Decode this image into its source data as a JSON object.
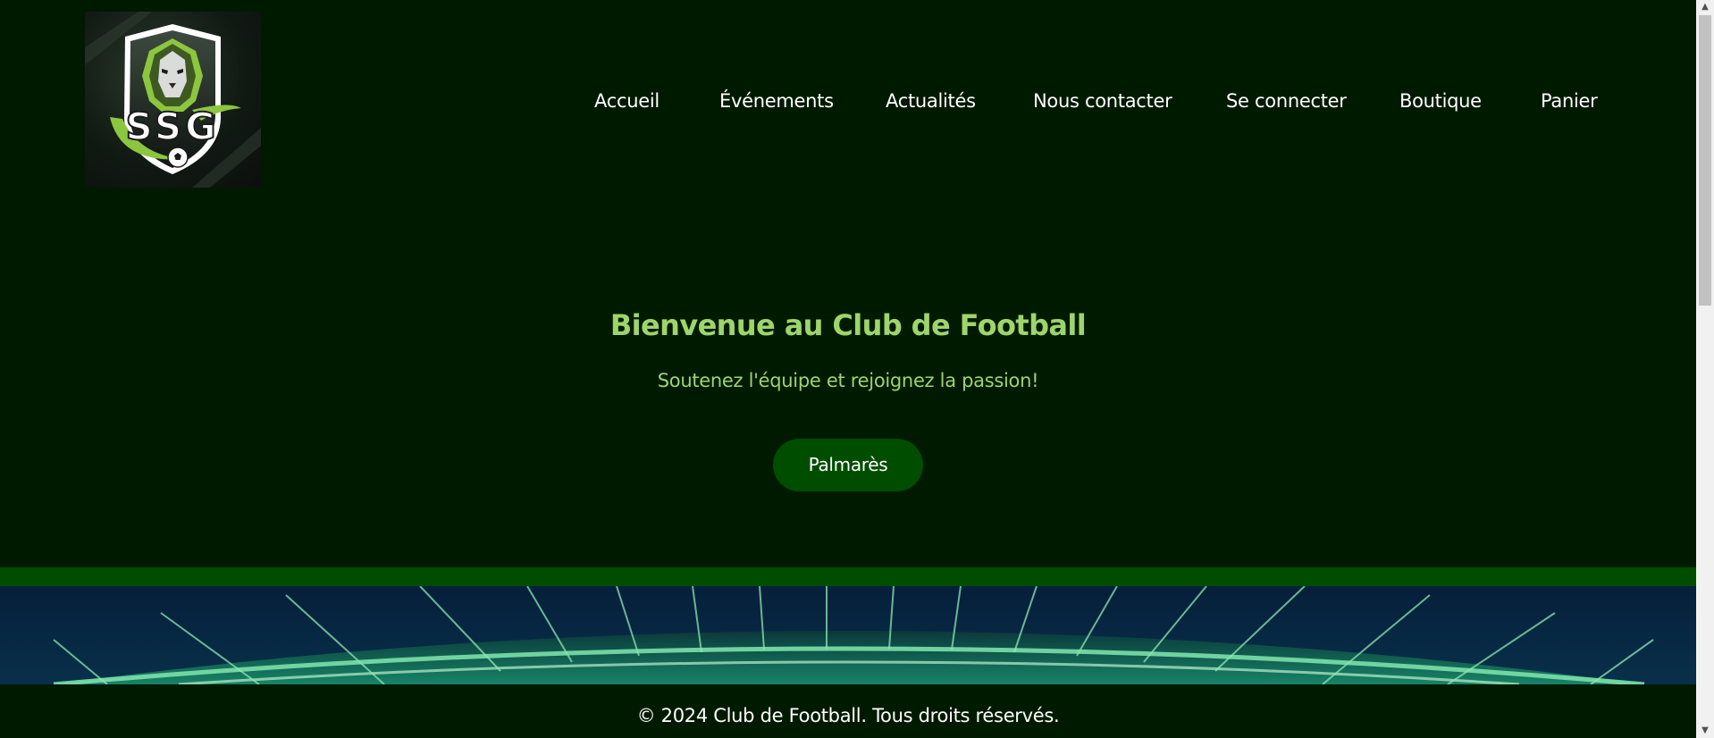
{
  "header": {
    "logo": {
      "text": "SSG",
      "icon": "lion-shield-logo"
    },
    "nav": [
      {
        "label": "Accueil"
      },
      {
        "label": "Événements"
      },
      {
        "label": "Actualités"
      },
      {
        "label": "Nous contacter"
      },
      {
        "label": "Se connecter"
      },
      {
        "label": "Boutique"
      },
      {
        "label": "Panier"
      }
    ]
  },
  "hero": {
    "title": "Bienvenue au Club de Football",
    "subtitle": "Soutenez l'équipe et rejoignez la passion!",
    "button_label": "Palmarès"
  },
  "footer": {
    "text": "© 2024 Club de Football. Tous droits réservés."
  },
  "colors": {
    "background": "#001a00",
    "accent_green": "#004d00",
    "title_green": "#9ed56b",
    "text": "#ffffff"
  },
  "scrollbar": {
    "up_icon": "scroll-up-arrow",
    "down_icon": "scroll-down-arrow"
  }
}
